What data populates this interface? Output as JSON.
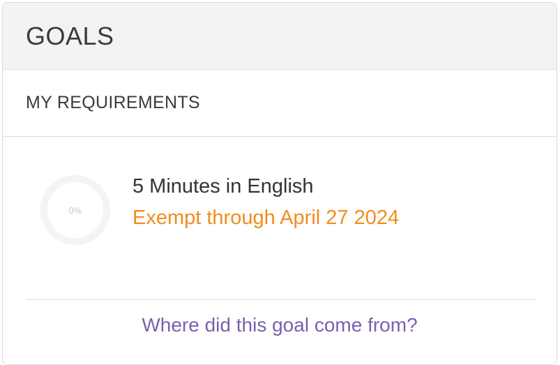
{
  "card": {
    "title": "GOALS",
    "section_title": "MY REQUIREMENTS",
    "requirement": {
      "progress_label": "0%",
      "progress": 0,
      "name": "5 Minutes in English",
      "status": "Exempt through April 27 2024"
    },
    "link_label": "Where did this goal come from?"
  },
  "colors": {
    "header_bg": "#f3f3f6",
    "status_orange": "#f28c1c",
    "link_purple": "#7a5fb0"
  }
}
